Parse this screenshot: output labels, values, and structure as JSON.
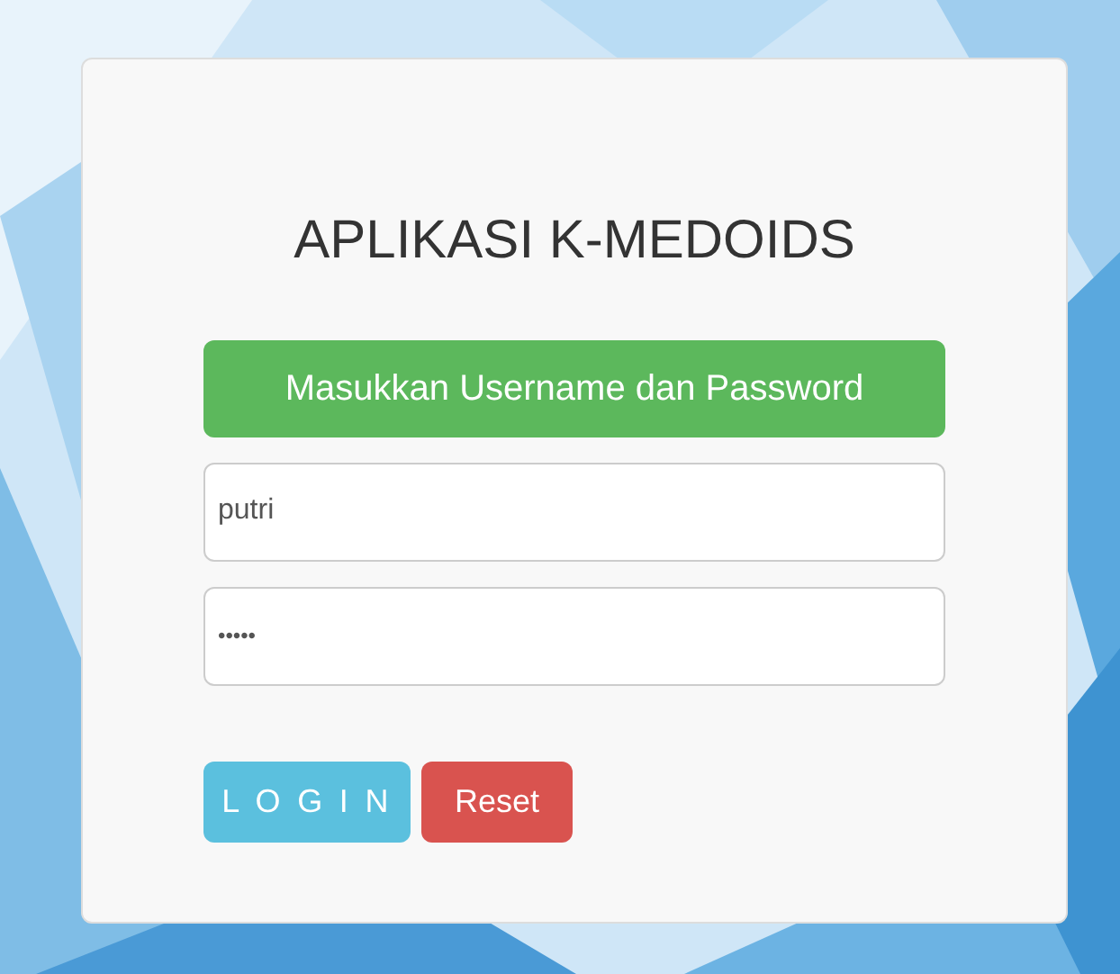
{
  "title": "APLIKASI K-MEDOIDS",
  "banner": "Masukkan Username dan Password",
  "fields": [
    {
      "kind": "text",
      "value": "putri"
    },
    {
      "kind": "password",
      "value": "•••••"
    }
  ],
  "buttons": [
    {
      "kind": "info",
      "label": "L O G I N"
    },
    {
      "kind": "danger",
      "label": "Reset"
    }
  ]
}
